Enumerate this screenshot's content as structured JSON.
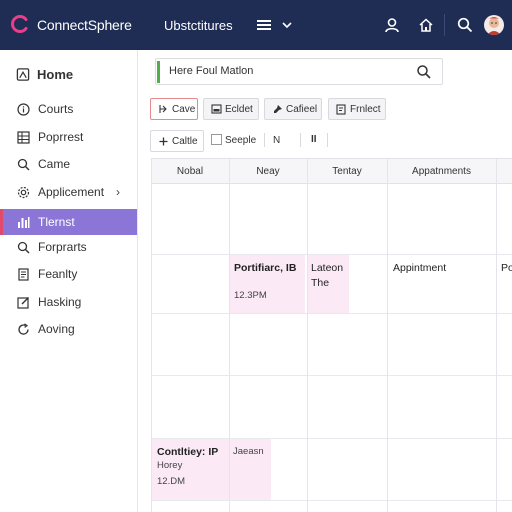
{
  "app": {
    "brand": "ConnectSphere",
    "section_title": "Ubstctitures"
  },
  "colors": {
    "topbar": "#1f2d55",
    "active_nav": "#8b76d8",
    "event_bg": "#fbeaf6",
    "accent_green": "#4fb04a"
  },
  "topbar_icons": [
    "menu-icon",
    "chevron-down-icon",
    "user-icon",
    "home-icon",
    "search-icon",
    "avatar"
  ],
  "sidebar": {
    "items": [
      {
        "label": "Home",
        "icon": "home-icon"
      },
      {
        "label": "Courts",
        "icon": "info-icon"
      },
      {
        "label": "Poprrest",
        "icon": "grid-icon"
      },
      {
        "label": "Came",
        "icon": "search-icon"
      },
      {
        "label": "Applicement",
        "icon": "settings-icon"
      },
      {
        "label": "Tlernst",
        "icon": "chart-icon"
      },
      {
        "label": "Forprarts",
        "icon": "search-icon"
      },
      {
        "label": "Feanlty",
        "icon": "document-icon"
      },
      {
        "label": "Hasking",
        "icon": "edit-icon"
      },
      {
        "label": "Aoving",
        "icon": "refresh-icon"
      }
    ]
  },
  "search": {
    "value": "Here Foul Matlon"
  },
  "toolbar": {
    "buttons": [
      "Cave",
      "Ecldet",
      "Cafieel",
      "Frnlect"
    ]
  },
  "filters": {
    "button_label": "Caltle",
    "checkbox_label": "Seeple",
    "prev": "N",
    "pause": "II"
  },
  "calendar": {
    "columns": [
      "Nobal",
      "Neay",
      "Tentay",
      "Appatnments"
    ],
    "events": {
      "e1_title": "Portifiarc, IB",
      "e1_time": "12.3PM",
      "e2_line1": "Lateon",
      "e2_line2": "The",
      "e3_title": "Appintment",
      "e4_text": "Po",
      "e5_title": "Contltiey: IP",
      "e5_sub": "Horey",
      "e5_time": "12.DM",
      "e6_text": "Jaeasn"
    }
  }
}
